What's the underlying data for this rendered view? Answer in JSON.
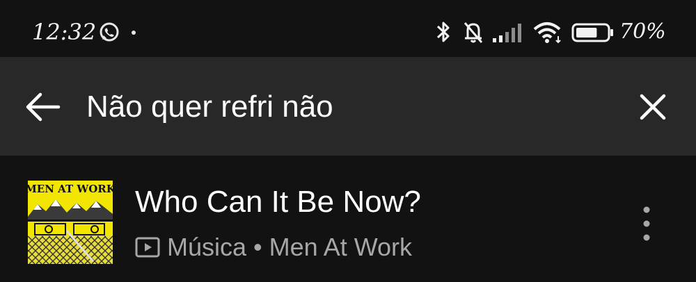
{
  "status_bar": {
    "time": "12:32",
    "battery_percent": "70%",
    "icons": [
      "whatsapp-icon",
      "notification-dot",
      "bluetooth-icon",
      "mute-icon",
      "signal-icon",
      "wifi-icon",
      "battery-icon"
    ],
    "battery_level": 0.7
  },
  "search": {
    "query": "Não quer refri não",
    "back_icon": "arrow-left-icon",
    "clear_icon": "close-icon"
  },
  "results": [
    {
      "title": "Who Can It Be Now?",
      "type": "Música",
      "separator": "•",
      "artist": "Men At Work",
      "album_art_text": "MEN AT WORK",
      "type_icon": "video-icon",
      "menu_icon": "more-vertical-icon"
    }
  ],
  "colors": {
    "background": "#121212",
    "search_bar": "#282828",
    "primary_text": "#ffffff",
    "secondary_text": "#a7a7a7",
    "album_yellow": "#f2e600"
  }
}
